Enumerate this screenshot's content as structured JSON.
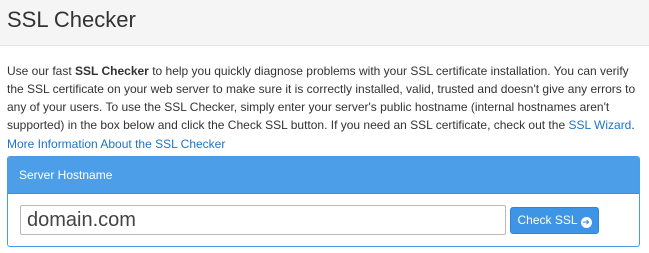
{
  "header": {
    "title": "SSL Checker"
  },
  "intro": {
    "part1": "Use our fast ",
    "bold": "SSL Checker",
    "part2": " to help you quickly diagnose problems with your SSL certificate installation. You can verify the SSL certificate on your web server to make sure it is correctly installed, valid, trusted and doesn't give any errors to any of your users. To use the SSL Checker, simply enter your server's public hostname (internal hostnames aren't supported) in the box below and click the Check SSL button. If you need an SSL certificate, check out the ",
    "wizard_link": "SSL Wizard",
    "end": "."
  },
  "more_info_link": "More Information About the SSL Checker",
  "form": {
    "heading": "Server Hostname",
    "hostname_value": "domain.com",
    "check_button_label": "Check SSL",
    "button_icon": "arrow-right-circle-icon"
  },
  "colors": {
    "link": "#1c74c7",
    "panel_heading": "#4d9ee9",
    "button": "#3e95e6"
  }
}
